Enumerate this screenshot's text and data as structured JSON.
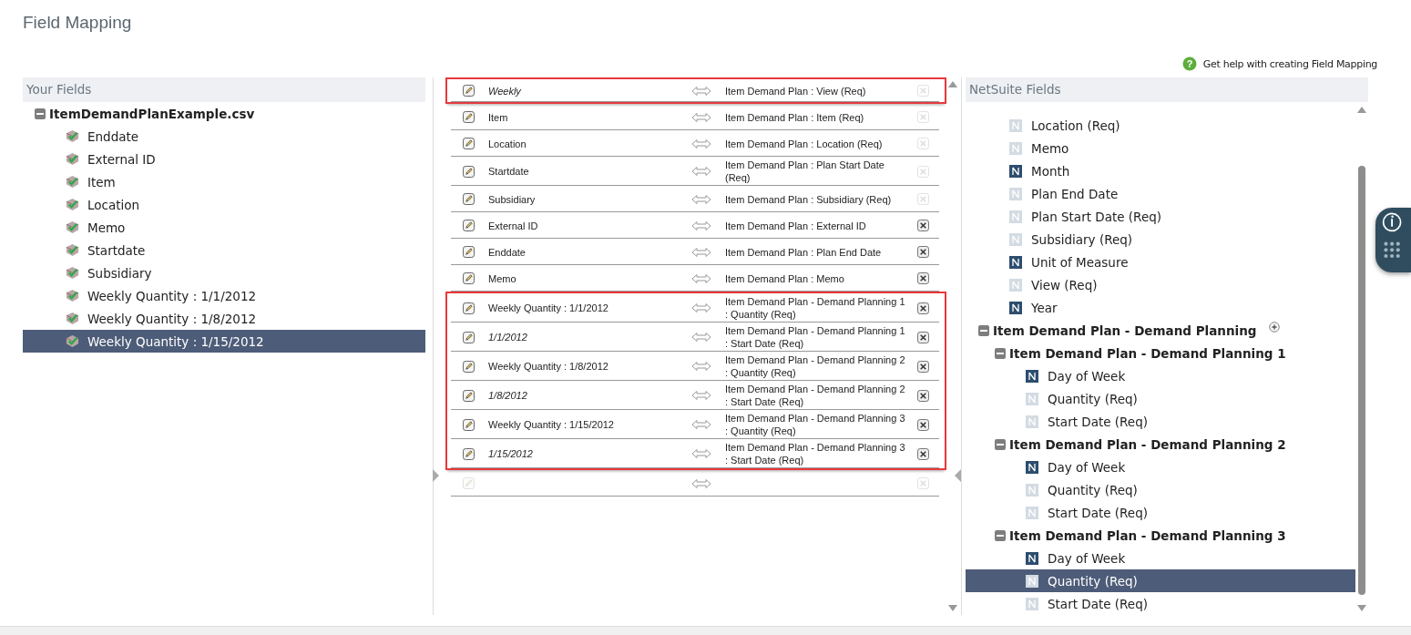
{
  "page_title": "Field Mapping",
  "help_icon": "?",
  "help_link": "Get help with creating Field Mapping",
  "your_fields": {
    "title": "Your Fields",
    "file": {
      "label": "ItemDemandPlanExample.csv",
      "expanded": true
    },
    "items": [
      {
        "label": "Enddate",
        "selected": false
      },
      {
        "label": "External ID",
        "selected": false
      },
      {
        "label": "Item",
        "selected": false
      },
      {
        "label": "Location",
        "selected": false
      },
      {
        "label": "Memo",
        "selected": false
      },
      {
        "label": "Startdate",
        "selected": false
      },
      {
        "label": "Subsidiary",
        "selected": false
      },
      {
        "label": "Weekly Quantity : 1/1/2012",
        "selected": false
      },
      {
        "label": "Weekly Quantity : 1/8/2012",
        "selected": false
      },
      {
        "label": "Weekly Quantity : 1/15/2012",
        "selected": true
      }
    ]
  },
  "mappings": [
    {
      "source": "Weekly",
      "kind": "constant",
      "target": "Item Demand Plan : View (Req)",
      "removable": false,
      "highlighted": true
    },
    {
      "source": "Item",
      "kind": "field",
      "target": "Item Demand Plan : Item (Req)",
      "removable": false,
      "highlighted": false
    },
    {
      "source": "Location",
      "kind": "field",
      "target": "Item Demand Plan : Location (Req)",
      "removable": false,
      "highlighted": false
    },
    {
      "source": "Startdate",
      "kind": "field",
      "target": "Item Demand Plan : Plan Start Date (Req)",
      "removable": false,
      "highlighted": false
    },
    {
      "source": "Subsidiary",
      "kind": "field",
      "target": "Item Demand Plan : Subsidiary (Req)",
      "removable": false,
      "highlighted": false
    },
    {
      "source": "External ID",
      "kind": "field",
      "target": "Item Demand Plan : External ID",
      "removable": true,
      "highlighted": false
    },
    {
      "source": "Enddate",
      "kind": "field",
      "target": "Item Demand Plan : Plan End Date",
      "removable": true,
      "highlighted": false
    },
    {
      "source": "Memo",
      "kind": "field",
      "target": "Item Demand Plan : Memo",
      "removable": true,
      "highlighted": false
    },
    {
      "source": "Weekly Quantity : 1/1/2012",
      "kind": "field",
      "target": "Item Demand Plan - Demand Planning 1 : Quantity (Req)",
      "removable": true,
      "highlighted": true
    },
    {
      "source": "1/1/2012",
      "kind": "constant",
      "target": "Item Demand Plan - Demand Planning 1 : Start Date (Req)",
      "removable": true,
      "highlighted": true
    },
    {
      "source": "Weekly Quantity : 1/8/2012",
      "kind": "field",
      "target": "Item Demand Plan - Demand Planning 2 : Quantity (Req)",
      "removable": true,
      "highlighted": true
    },
    {
      "source": "1/8/2012",
      "kind": "constant",
      "target": "Item Demand Plan - Demand Planning 2 : Start Date (Req)",
      "removable": true,
      "highlighted": true
    },
    {
      "source": "Weekly Quantity : 1/15/2012",
      "kind": "field",
      "target": "Item Demand Plan - Demand Planning 3 : Quantity (Req)",
      "removable": true,
      "highlighted": true
    },
    {
      "source": "1/15/2012",
      "kind": "constant",
      "target": "Item Demand Plan - Demand Planning 3 : Start Date (Req)",
      "removable": true,
      "highlighted": true
    },
    {
      "kind": "empty",
      "removable": false,
      "highlighted": false
    }
  ],
  "netsuite_fields": {
    "title": "NetSuite Fields",
    "items": [
      {
        "label": "Location (Req)",
        "mapped": true,
        "selected": false
      },
      {
        "label": "Memo",
        "mapped": true,
        "selected": false
      },
      {
        "label": "Month",
        "mapped": false,
        "selected": false
      },
      {
        "label": "Plan End Date",
        "mapped": true,
        "selected": false
      },
      {
        "label": "Plan Start Date (Req)",
        "mapped": true,
        "selected": false
      },
      {
        "label": "Subsidiary (Req)",
        "mapped": true,
        "selected": false
      },
      {
        "label": "Unit of Measure",
        "mapped": false,
        "selected": false
      },
      {
        "label": "View (Req)",
        "mapped": true,
        "selected": false
      },
      {
        "label": "Year",
        "mapped": false,
        "selected": false
      }
    ],
    "group": {
      "label": "Item Demand Plan - Demand Planning",
      "expanded": true,
      "children": [
        {
          "label": "Item Demand Plan - Demand Planning 1",
          "expanded": true,
          "children": [
            {
              "label": "Day of Week",
              "mapped": false,
              "selected": false
            },
            {
              "label": "Quantity (Req)",
              "mapped": true,
              "selected": false
            },
            {
              "label": "Start Date (Req)",
              "mapped": true,
              "selected": false
            }
          ]
        },
        {
          "label": "Item Demand Plan - Demand Planning 2",
          "expanded": true,
          "children": [
            {
              "label": "Day of Week",
              "mapped": false,
              "selected": false
            },
            {
              "label": "Quantity (Req)",
              "mapped": true,
              "selected": false
            },
            {
              "label": "Start Date (Req)",
              "mapped": true,
              "selected": false
            }
          ]
        },
        {
          "label": "Item Demand Plan - Demand Planning 3",
          "expanded": true,
          "children": [
            {
              "label": "Day of Week",
              "mapped": false,
              "selected": false
            },
            {
              "label": "Quantity (Req)",
              "mapped": true,
              "selected": true
            },
            {
              "label": "Start Date (Req)",
              "mapped": true,
              "selected": false
            }
          ]
        }
      ]
    }
  }
}
